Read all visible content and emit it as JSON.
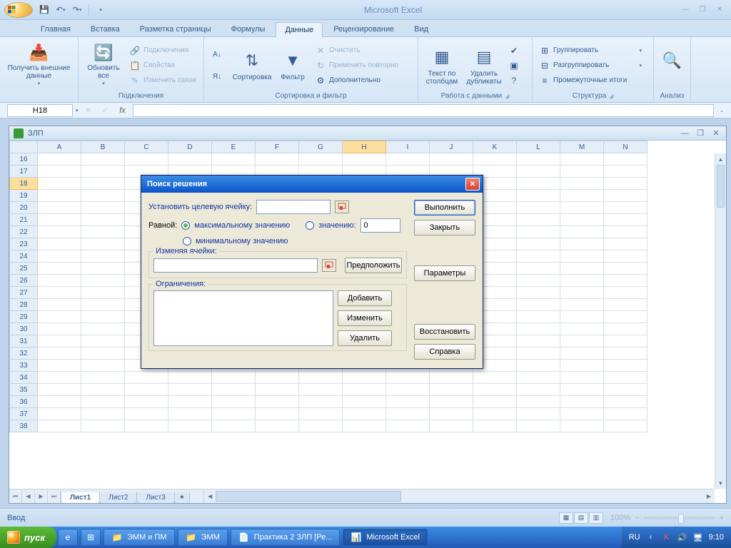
{
  "app": {
    "title": "Microsoft Excel"
  },
  "tabs": {
    "home": "Главная",
    "insert": "Вставка",
    "layout": "Разметка страницы",
    "formulas": "Формулы",
    "data": "Данные",
    "review": "Рецензирование",
    "view": "Вид"
  },
  "ribbon": {
    "external": {
      "label": "Получить внешние данные"
    },
    "connections": {
      "refresh": "Обновить все",
      "item1": "Подключения",
      "item2": "Свойства",
      "item3": "Изменить связи",
      "group": "Подключения"
    },
    "sort": {
      "sort_btn": "Сортировка",
      "filter_btn": "Фильтр",
      "clear": "Очистить",
      "reapply": "Применить повторно",
      "advanced": "Дополнительно",
      "group": "Сортировка и фильтр"
    },
    "datatools": {
      "text_cols": "Текст по столбцам",
      "remove_dup": "Удалить дубликаты",
      "group": "Работа с данными"
    },
    "outline": {
      "group_btn": "Группировать",
      "ungroup": "Разгруппировать",
      "subtotal": "Промежуточные итоги",
      "group": "Структура"
    },
    "analysis": {
      "group": "Анализ"
    }
  },
  "namebox": "H18",
  "doc": {
    "title": "ЗЛП"
  },
  "columns": [
    "A",
    "B",
    "C",
    "D",
    "E",
    "F",
    "G",
    "H",
    "I",
    "J",
    "K",
    "L",
    "M",
    "N"
  ],
  "rows": [
    "16",
    "17",
    "18",
    "19",
    "20",
    "21",
    "22",
    "23",
    "24",
    "25",
    "26",
    "27",
    "28",
    "29",
    "30",
    "31",
    "32",
    "33",
    "34",
    "35",
    "36",
    "37",
    "38"
  ],
  "sheets": {
    "s1": "Лист1",
    "s2": "Лист2",
    "s3": "Лист3"
  },
  "status": {
    "mode": "Ввод",
    "zoom": "100%"
  },
  "dialog": {
    "title": "Поиск решения",
    "target_label": "Установить целевую ячейку:",
    "target_value": "",
    "equal_label": "Равной:",
    "opt_max": "максимальному значению",
    "opt_min": "минимальному значению",
    "opt_val": "значению:",
    "val_input": "0",
    "changing_label": "Изменяя ячейки:",
    "changing_value": "",
    "constraints_label": "Ограничения:",
    "btn_guess": "Предположить",
    "btn_add": "Добавить",
    "btn_change": "Изменить",
    "btn_delete": "Удалить",
    "btn_solve": "Выполнить",
    "btn_close": "Закрыть",
    "btn_options": "Параметры",
    "btn_reset": "Восстановить",
    "btn_help": "Справка"
  },
  "taskbar": {
    "start": "пуск",
    "t1": "ЭММ и ПМ",
    "t2": "ЭММ",
    "t3": "Практика 2 ЗЛП [Ре...",
    "t4": "Microsoft Excel",
    "lang": "RU",
    "time": "9:10"
  }
}
